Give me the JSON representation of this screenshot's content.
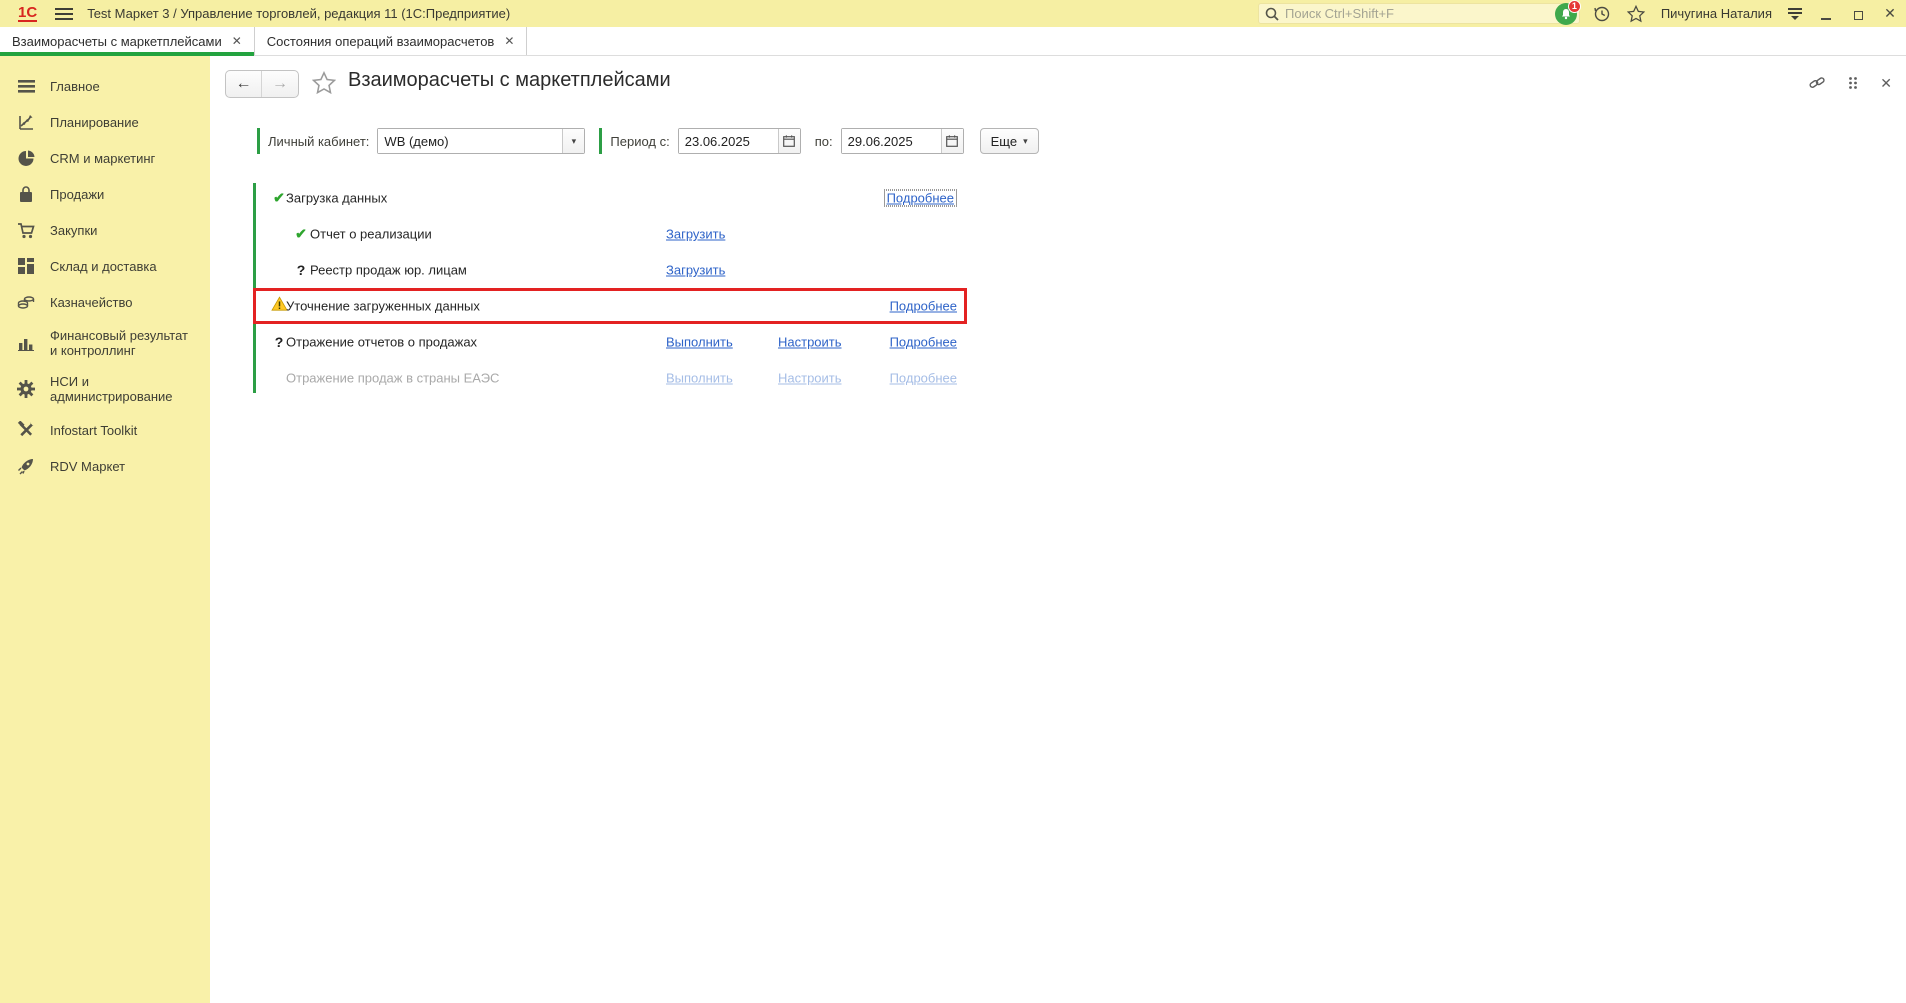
{
  "titlebar": {
    "app_title": "Test Маркет 3 / Управление торговлей, редакция 11  (1С:Предприятие)",
    "search_placeholder": "Поиск Ctrl+Shift+F",
    "user_name": "Пичугина Наталия",
    "notification_count": "1"
  },
  "tabs": [
    {
      "label": "Взаиморасчеты с маркетплейсами"
    },
    {
      "label": "Состояния операций взаиморасчетов"
    }
  ],
  "sidebar": {
    "items": [
      {
        "label": "Главное",
        "icon": "menu-lines-icon"
      },
      {
        "label": "Планирование",
        "icon": "planning-chart-icon"
      },
      {
        "label": "CRM и маркетинг",
        "icon": "pie-chart-icon"
      },
      {
        "label": "Продажи",
        "icon": "shopping-bag-icon"
      },
      {
        "label": "Закупки",
        "icon": "cart-icon"
      },
      {
        "label": "Склад и доставка",
        "icon": "boxes-icon"
      },
      {
        "label": "Казначейство",
        "icon": "coins-icon"
      },
      {
        "label": "Финансовый результат и контроллинг",
        "icon": "bar-chart-icon"
      },
      {
        "label": "НСИ и администрирование",
        "icon": "gear-icon"
      },
      {
        "label": "Infostart Toolkit",
        "icon": "tools-icon"
      },
      {
        "label": "RDV Маркет",
        "icon": "rocket-icon"
      }
    ]
  },
  "content": {
    "title": "Взаиморасчеты с маркетплейсами",
    "filters": {
      "cabinet_label": "Личный кабинет:",
      "cabinet_value": "WB (демо)",
      "period_from_label": "Период с:",
      "period_from_value": "23.06.2025",
      "period_to_label": "по:",
      "period_to_value": "29.06.2025",
      "more_button": "Еще"
    },
    "operations": [
      {
        "status": "done",
        "label": "Загрузка данных",
        "links": {
          "details": "Подробнее"
        }
      },
      {
        "status": "done",
        "label": "Отчет о реализации",
        "links": {
          "action": "Загрузить"
        }
      },
      {
        "status": "question",
        "label": "Реестр продаж юр. лицам",
        "links": {
          "action": "Загрузить"
        }
      },
      {
        "status": "warning",
        "label": "Уточнение загруженных данных",
        "links": {
          "details": "Подробнее"
        }
      },
      {
        "status": "question",
        "label": "Отражение отчетов о продажах",
        "links": {
          "action": "Выполнить",
          "configure": "Настроить",
          "details": "Подробнее"
        }
      },
      {
        "status": "none",
        "label": "Отражение продаж в страны ЕАЭС",
        "disabled": true,
        "links": {
          "action": "Выполнить",
          "configure": "Настроить",
          "details": "Подробнее"
        }
      }
    ]
  },
  "icons": {
    "check": "✔",
    "question": "?",
    "close": "✕",
    "caret_down": "▾"
  },
  "colors": {
    "titlebar_bg": "#F6EFA3",
    "sidebar_bg": "#F9F1A9",
    "accent_green": "#23A33F",
    "warning_border_red": "#E32222",
    "link_blue": "#2E63C8",
    "notification_green": "#3FA94C",
    "badge_red": "#E53935",
    "warning_yellow": "#FFC926"
  }
}
